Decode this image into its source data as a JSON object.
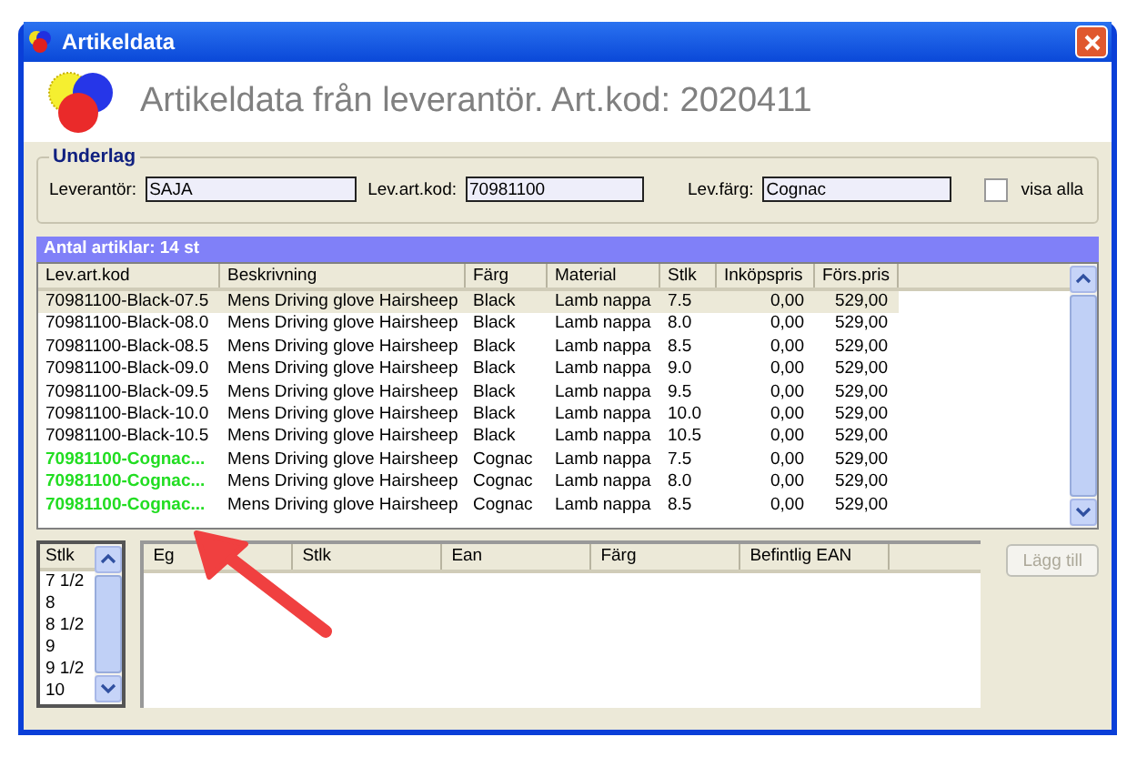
{
  "window": {
    "title": "Artikeldata",
    "heading": "Artikeldata från leverantör. Art.kod: 2020411"
  },
  "underlag": {
    "title": "Underlag",
    "fields": [
      {
        "label": "Leverantör:",
        "value": "SAJA"
      },
      {
        "label": "Lev.art.kod:",
        "value": "70981100"
      },
      {
        "label": "Lev.färg:",
        "value": "Cognac"
      }
    ],
    "visa_alla": {
      "label": "visa alla",
      "checked": false
    }
  },
  "table": {
    "caption": "Antal artiklar: 14 st",
    "columns": [
      "Lev.art.kod",
      "Beskrivning",
      "Färg",
      "Material",
      "Stlk",
      "Inköpspris",
      "Förs.pris"
    ],
    "rows": [
      {
        "selected": true,
        "marked": false,
        "cells": [
          "70981100-Black-07.5",
          "Mens Driving glove Hairsheep",
          "Black",
          "Lamb nappa",
          "7.5",
          "0,00",
          "529,00"
        ]
      },
      {
        "selected": false,
        "marked": false,
        "cells": [
          "70981100-Black-08.0",
          "Mens Driving glove Hairsheep",
          "Black",
          "Lamb nappa",
          "8.0",
          "0,00",
          "529,00"
        ]
      },
      {
        "selected": false,
        "marked": false,
        "cells": [
          "70981100-Black-08.5",
          "Mens Driving glove Hairsheep",
          "Black",
          "Lamb nappa",
          "8.5",
          "0,00",
          "529,00"
        ]
      },
      {
        "selected": false,
        "marked": false,
        "cells": [
          "70981100-Black-09.0",
          "Mens Driving glove Hairsheep",
          "Black",
          "Lamb nappa",
          "9.0",
          "0,00",
          "529,00"
        ]
      },
      {
        "selected": false,
        "marked": false,
        "cells": [
          "70981100-Black-09.5",
          "Mens Driving glove Hairsheep",
          "Black",
          "Lamb nappa",
          "9.5",
          "0,00",
          "529,00"
        ]
      },
      {
        "selected": false,
        "marked": false,
        "cells": [
          "70981100-Black-10.0",
          "Mens Driving glove Hairsheep",
          "Black",
          "Lamb nappa",
          "10.0",
          "0,00",
          "529,00"
        ]
      },
      {
        "selected": false,
        "marked": false,
        "cells": [
          "70981100-Black-10.5",
          "Mens Driving glove Hairsheep",
          "Black",
          "Lamb nappa",
          "10.5",
          "0,00",
          "529,00"
        ]
      },
      {
        "selected": false,
        "marked": true,
        "cells": [
          "70981100-Cognac...",
          "Mens Driving glove Hairsheep",
          "Cognac",
          "Lamb nappa",
          "7.5",
          "0,00",
          "529,00"
        ]
      },
      {
        "selected": false,
        "marked": true,
        "cells": [
          "70981100-Cognac...",
          "Mens Driving glove Hairsheep",
          "Cognac",
          "Lamb nappa",
          "8.0",
          "0,00",
          "529,00"
        ]
      },
      {
        "selected": false,
        "marked": true,
        "cells": [
          "70981100-Cognac...",
          "Mens Driving glove Hairsheep",
          "Cognac",
          "Lamb nappa",
          "8.5",
          "0,00",
          "529,00"
        ]
      }
    ]
  },
  "sizes": {
    "header": "Stlk",
    "items": [
      "7 1/2",
      "8",
      "8 1/2",
      "9",
      "9 1/2",
      "10"
    ]
  },
  "ean_table": {
    "columns": [
      "Eg",
      "Stlk",
      "Ean",
      "Färg",
      "Befintlig EAN"
    ]
  },
  "add_button": {
    "label": "Lägg till",
    "disabled": true
  }
}
